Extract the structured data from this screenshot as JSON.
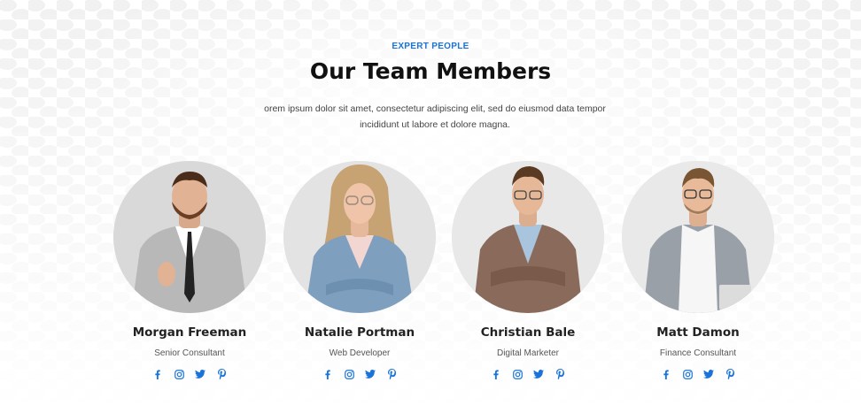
{
  "section": {
    "eyebrow": "EXPERT PEOPLE",
    "title": "Our Team Members",
    "description": "orem ipsum dolor sit amet, consectetur adipiscing elit, sed do eiusmod data tempor incididunt ut labore et dolore magna."
  },
  "members": [
    {
      "name": "Morgan Freeman",
      "role": "Senior Consultant"
    },
    {
      "name": "Natalie Portman",
      "role": "Web Developer"
    },
    {
      "name": "Christian Bale",
      "role": "Digital Marketer"
    },
    {
      "name": "Matt Damon",
      "role": "Finance Consultant"
    }
  ],
  "social_icons": [
    "facebook-icon",
    "instagram-icon",
    "twitter-icon",
    "pinterest-icon"
  ],
  "colors": {
    "accent": "#1a73d9",
    "heading": "#111111",
    "text": "#444444",
    "background": "#ffffff",
    "dots": "#f2f2f2"
  }
}
